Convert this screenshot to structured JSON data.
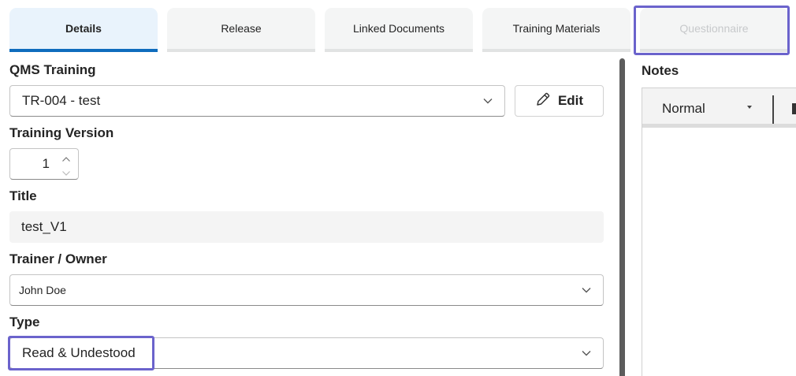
{
  "tabs": [
    {
      "label": "Details"
    },
    {
      "label": "Release"
    },
    {
      "label": "Linked Documents"
    },
    {
      "label": "Training Materials"
    },
    {
      "label": "Questionnaire"
    }
  ],
  "form": {
    "qms_training": {
      "label": "QMS Training",
      "value": "TR-004 - test",
      "edit_label": "Edit"
    },
    "training_version": {
      "label": "Training Version",
      "value": "1"
    },
    "title": {
      "label": "Title",
      "value": "test_V1"
    },
    "trainer": {
      "label": "Trainer / Owner",
      "value": "John Doe"
    },
    "type": {
      "label": "Type",
      "value": "Read & Undestood"
    }
  },
  "notes": {
    "label": "Notes",
    "format_value": "Normal"
  },
  "icons": {
    "chevron": "chevron-down-icon",
    "edit": "pencil-icon",
    "spin_up": "chevron-up-icon",
    "spin_down": "chevron-down-icon",
    "dropdown_caret": "caret-down-icon"
  },
  "colors": {
    "active_tab_bg": "#e9f3fc",
    "active_tab_underline": "#0f6cbd",
    "highlight": "#6b63cc"
  }
}
